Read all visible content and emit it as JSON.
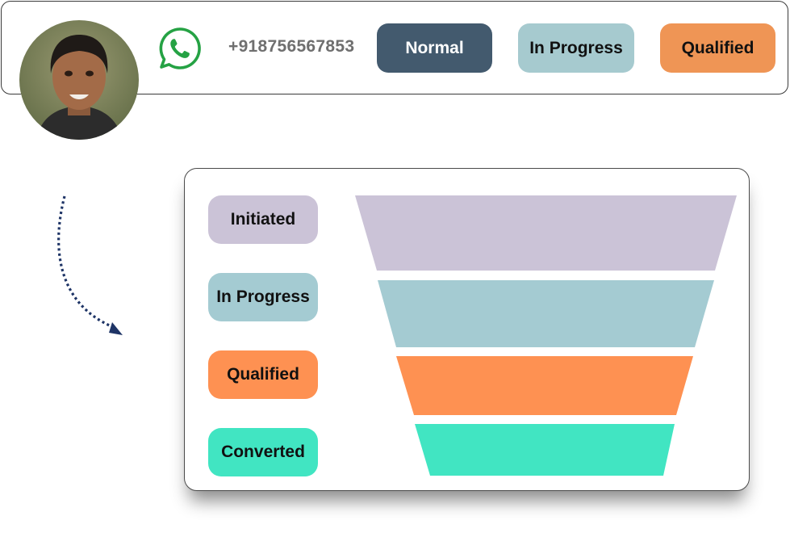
{
  "contact": {
    "phone": "+918756567853",
    "tags": [
      {
        "label": "Normal",
        "color": "#435a6e"
      },
      {
        "label": "In Progress",
        "color": "#a6cacf"
      },
      {
        "label": "Qualified",
        "color": "#ef9555"
      }
    ],
    "icons": {
      "whatsapp": "whatsapp-icon",
      "avatar": "avatar"
    }
  },
  "funnel": {
    "stages": [
      {
        "label": "Initiated",
        "color": "#cbc3d7"
      },
      {
        "label": "In Progress",
        "color": "#a4cbd2"
      },
      {
        "label": "Qualified",
        "color": "#fe9152"
      },
      {
        "label": "Converted",
        "color": "#41e5c2"
      }
    ]
  },
  "colors": {
    "whatsapp": "#25a244",
    "arrow": "#1e3466"
  }
}
